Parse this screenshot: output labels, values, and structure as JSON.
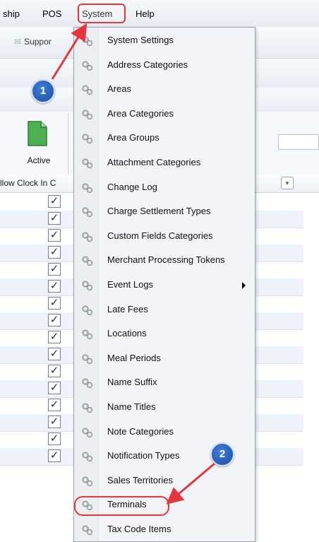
{
  "menubar": {
    "items": [
      {
        "label": "ship"
      },
      {
        "label": "POS"
      },
      {
        "label": "System"
      },
      {
        "label": "Help"
      }
    ]
  },
  "toolbar": {
    "support_label": "Suppor",
    "active_label": "Active"
  },
  "grid": {
    "column_header": "llow Clock In C",
    "rows_checked": [
      true,
      true,
      true,
      true,
      true,
      true,
      true,
      true,
      true,
      true,
      true,
      true,
      true,
      true,
      true,
      true,
      true,
      true,
      true,
      true
    ]
  },
  "system_menu": {
    "items": [
      {
        "label": "System Settings"
      },
      {
        "label": "Address Categories"
      },
      {
        "label": "Areas"
      },
      {
        "label": "Area Categories"
      },
      {
        "label": "Area Groups"
      },
      {
        "label": "Attachment Categories"
      },
      {
        "label": "Change Log"
      },
      {
        "label": "Charge Settlement Types"
      },
      {
        "label": "Custom Fields Categories"
      },
      {
        "label": "Merchant Processing Tokens"
      },
      {
        "label": "Event Logs",
        "has_submenu": true
      },
      {
        "label": "Late Fees"
      },
      {
        "label": "Locations"
      },
      {
        "label": "Meal Periods"
      },
      {
        "label": "Name Suffix"
      },
      {
        "label": "Name Titles"
      },
      {
        "label": "Note Categories"
      },
      {
        "label": "Notification Types"
      },
      {
        "label": "Sales Territories"
      },
      {
        "label": "Terminals"
      },
      {
        "label": "Tax Code Items"
      }
    ]
  },
  "annotations": {
    "step1": "1",
    "step2": "2",
    "highlight_color": "#e3373d",
    "badge_color": "#1d4e9e"
  }
}
